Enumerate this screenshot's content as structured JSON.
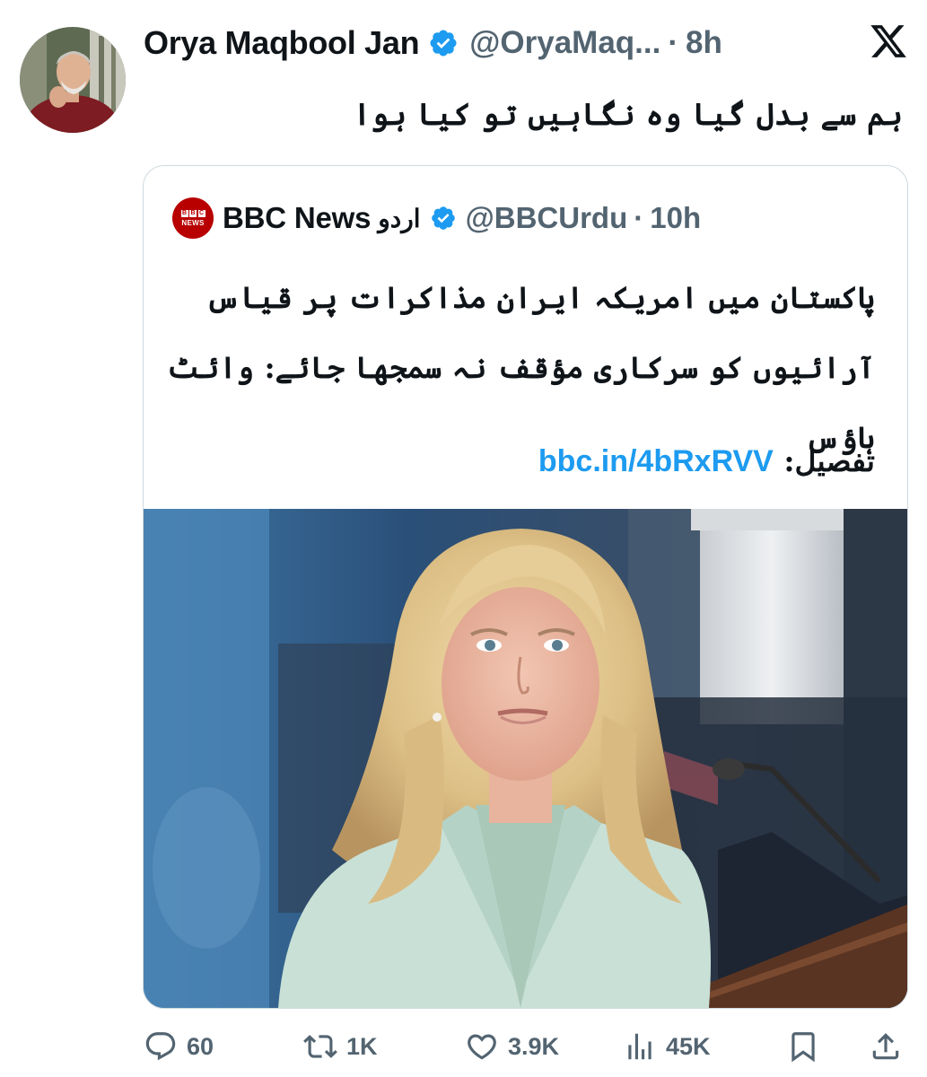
{
  "tweet": {
    "author_name": "Orya Maqbool Jan",
    "author_handle": "@OryaMaq...",
    "separator": "·",
    "time": "8h",
    "text": "ہم سے بدل گیا وہ نگاہیں تو کیا ہوا",
    "verified": true
  },
  "quote": {
    "logo_text": "BBC NEWS",
    "logo_blocks": [
      "B",
      "B",
      "C"
    ],
    "logo_news": "NEWS",
    "name": "BBC News",
    "name_urdu": "اردو",
    "handle": "@BBCUrdu",
    "separator": "·",
    "time": "10h",
    "text": "پاکستان میں امریکہ ایران مذاکرات پر قیاس آرائیوں کو سرکاری مؤقف نہ سمجھا جائے: وائٹ ہاؤس",
    "detail_label": "تفصیل: ",
    "link": "bbc.in/4bRxRVV",
    "image_alt": "Woman with blonde hair in a light green jacket at a podium with a microphone"
  },
  "actions": {
    "reply_count": "60",
    "retweet_count": "1K",
    "like_count": "3.9K",
    "views_count": "45K"
  },
  "colors": {
    "text": "#0f1419",
    "secondary": "#536471",
    "accent": "#1d9bf0",
    "border": "#cfd9de",
    "bbc_red": "#b80000"
  },
  "icons": {
    "platform": "x-logo-icon",
    "verified": "verified-badge-icon",
    "reply": "reply-icon",
    "retweet": "retweet-icon",
    "like": "heart-icon",
    "views": "views-chart-icon",
    "bookmark": "bookmark-icon",
    "share": "share-icon"
  }
}
